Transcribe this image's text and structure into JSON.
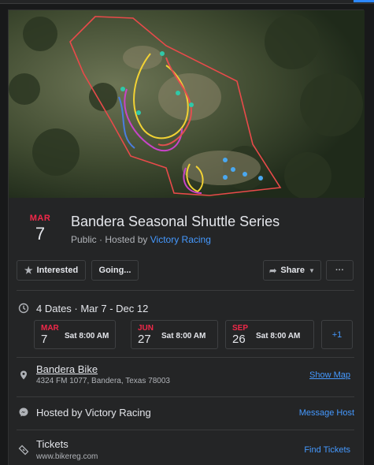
{
  "event": {
    "cover_alt_icon": "satellite-trail-map",
    "month": "MAR",
    "day": "7",
    "title": "Bandera Seasonal Shuttle Series",
    "privacy": "Public",
    "hosted_by_prefix": "Hosted by",
    "host_name": "Victory Racing",
    "separator": "·"
  },
  "actions": {
    "interested_label": "Interested",
    "interested_icon": "star-icon",
    "going_label": "Going...",
    "share_label": "Share",
    "share_icon": "share-arrow-icon",
    "more_label": "···"
  },
  "dates": {
    "summary": "4 Dates · Mar 7 - Dec 12",
    "items": [
      {
        "month": "MAR",
        "day": "7",
        "time": "Sat 8:00 AM"
      },
      {
        "month": "JUN",
        "day": "27",
        "time": "Sat 8:00 AM"
      },
      {
        "month": "SEP",
        "day": "26",
        "time": "Sat 8:00 AM"
      }
    ],
    "more_label": "+1"
  },
  "location": {
    "name": "Bandera Bike",
    "address": "4324 FM 1077, Bandera, Texas 78003",
    "show_map_label": "Show Map"
  },
  "host": {
    "text": "Hosted by Victory Racing",
    "message_label": "Message Host"
  },
  "tickets": {
    "label": "Tickets",
    "url": "www.bikereg.com",
    "find_label": "Find Tickets"
  },
  "colors": {
    "background": "#18191a",
    "card": "#242526",
    "accent_red": "#f02849",
    "link_blue": "#4599ff"
  }
}
